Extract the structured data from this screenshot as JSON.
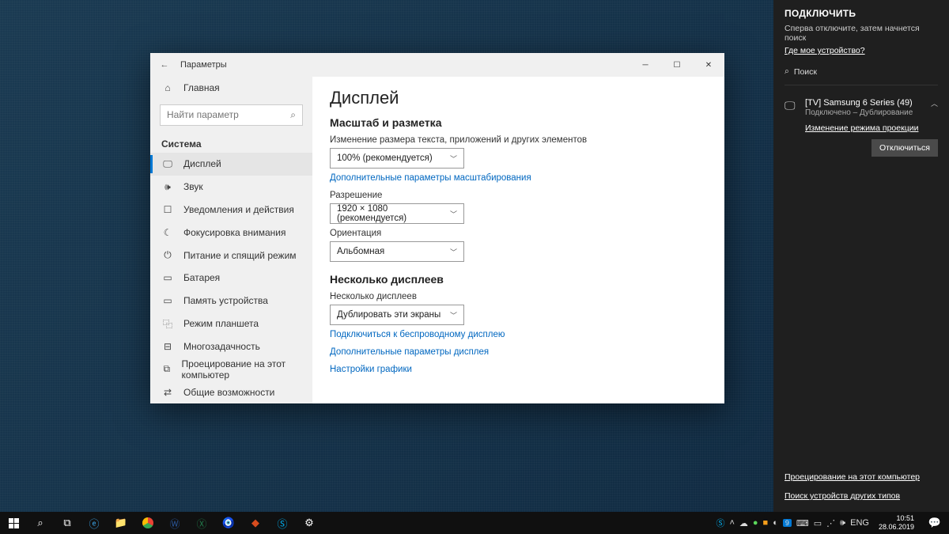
{
  "window": {
    "title": "Параметры",
    "home": "Главная",
    "search_placeholder": "Найти параметр",
    "nav_header": "Система",
    "nav": [
      {
        "id": "display",
        "label": "Дисплей"
      },
      {
        "id": "sound",
        "label": "Звук"
      },
      {
        "id": "notifications",
        "label": "Уведомления и действия"
      },
      {
        "id": "focus",
        "label": "Фокусировка внимания"
      },
      {
        "id": "power",
        "label": "Питание и спящий режим"
      },
      {
        "id": "battery",
        "label": "Батарея"
      },
      {
        "id": "storage",
        "label": "Память устройства"
      },
      {
        "id": "tablet",
        "label": "Режим планшета"
      },
      {
        "id": "multitask",
        "label": "Многозадачность"
      },
      {
        "id": "project",
        "label": "Проецирование на этот компьютер"
      },
      {
        "id": "shared",
        "label": "Общие возможности"
      }
    ]
  },
  "content": {
    "h1": "Дисплей",
    "scale_h": "Масштаб и разметка",
    "scale_lbl": "Изменение размера текста, приложений и других элементов",
    "scale_val": "100% (рекомендуется)",
    "scale_link": "Дополнительные параметры масштабирования",
    "res_lbl": "Разрешение",
    "res_val": "1920 × 1080 (рекомендуется)",
    "orient_lbl": "Ориентация",
    "orient_val": "Альбомная",
    "multi_h": "Несколько дисплеев",
    "multi_lbl": "Несколько дисплеев",
    "multi_val": "Дублировать эти экраны",
    "wireless_link": "Подключиться к беспроводному дисплею",
    "adv_link": "Дополнительные параметры дисплея",
    "gfx_link": "Настройки графики"
  },
  "panel": {
    "title": "ПОДКЛЮЧИТЬ",
    "sub": "Сперва отключите, затем начнется поиск",
    "where": "Где мое устройство?",
    "search": "Поиск",
    "dev_name": "[TV] Samsung 6 Series (49)",
    "dev_status": "Подключено – Дублирование",
    "mode": "Изменение режима проекции",
    "disconnect": "Отключиться",
    "bottom1": "Проецирование на этот компьютер",
    "bottom2": "Поиск устройств других типов"
  },
  "taskbar": {
    "lang": "ENG",
    "badge": "9",
    "time": "10:51",
    "date": "28.06.2019"
  }
}
